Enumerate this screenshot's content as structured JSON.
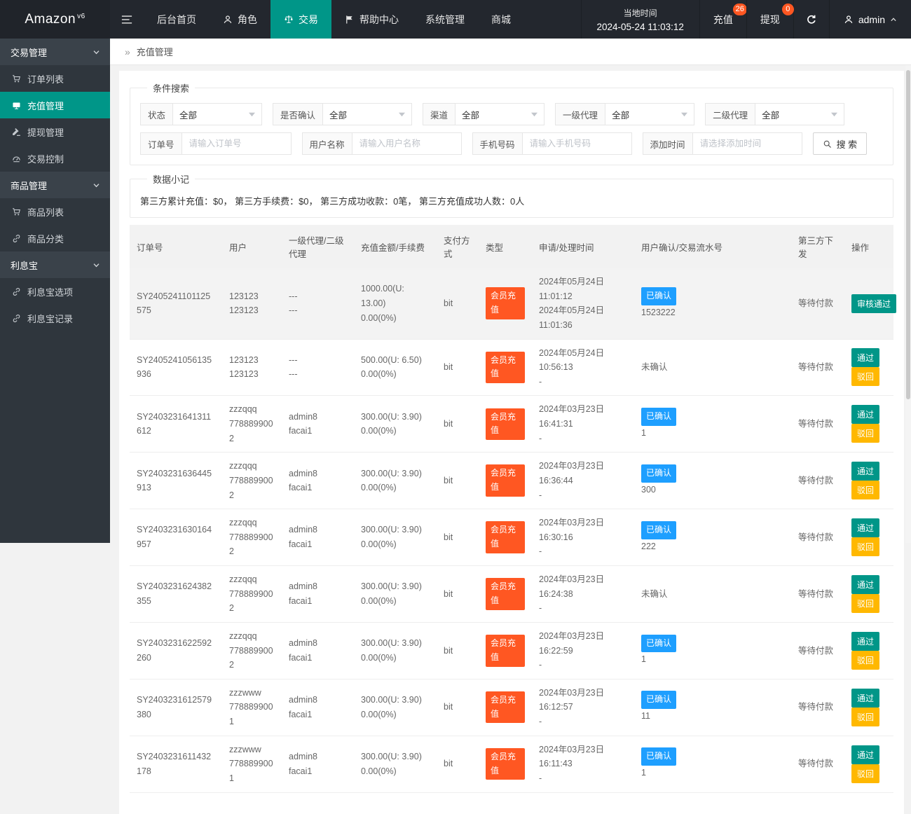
{
  "colors": {
    "accent": "#009688",
    "danger": "#ff5722",
    "info": "#1e9fff",
    "warning": "#ffb800",
    "navbar_bg": "#23272e",
    "sidebar_bg": "#2f363d"
  },
  "navbar": {
    "logo": {
      "text": "Amazon",
      "version": "v6"
    },
    "menu": [
      {
        "name": "home",
        "label": "后台首页",
        "icon": null,
        "active": false
      },
      {
        "name": "roles",
        "label": "角色",
        "icon": "user",
        "active": false
      },
      {
        "name": "trade",
        "label": "交易",
        "icon": "scales",
        "active": true
      },
      {
        "name": "help",
        "label": "帮助中心",
        "icon": "flag",
        "active": false
      },
      {
        "name": "system",
        "label": "系统管理",
        "icon": null,
        "active": false
      },
      {
        "name": "mall",
        "label": "商城",
        "icon": null,
        "active": false
      }
    ],
    "time": {
      "label": "当地时间",
      "value": "2024-05-24 11:03:12"
    },
    "quick": [
      {
        "label": "充值",
        "badge": "26"
      },
      {
        "label": "提现",
        "badge": "0"
      }
    ],
    "user": {
      "name": "admin"
    }
  },
  "sidebar": {
    "groups": [
      {
        "name": "trade-management",
        "label": "交易管理",
        "items": [
          {
            "name": "order-list",
            "label": "订单列表",
            "icon": "cart",
            "active": false
          },
          {
            "name": "recharge-management",
            "label": "充值管理",
            "icon": "card",
            "active": true
          },
          {
            "name": "withdraw-management",
            "label": "提现管理",
            "icon": "gavel",
            "active": false
          },
          {
            "name": "trade-control",
            "label": "交易控制",
            "icon": "gauge",
            "active": false
          }
        ]
      },
      {
        "name": "product-management",
        "label": "商品管理",
        "items": [
          {
            "name": "product-list",
            "label": "商品列表",
            "icon": "cart",
            "active": false
          },
          {
            "name": "product-category",
            "label": "商品分类",
            "icon": "link",
            "active": false
          }
        ]
      },
      {
        "name": "interest-bao",
        "label": "利息宝",
        "items": [
          {
            "name": "interest-options",
            "label": "利息宝选项",
            "icon": "link",
            "active": false
          },
          {
            "name": "interest-records",
            "label": "利息宝记录",
            "icon": "link",
            "active": false
          }
        ]
      }
    ]
  },
  "breadcrumb": {
    "icon": "»",
    "label": "充值管理"
  },
  "search": {
    "legend": "条件搜索",
    "selects": [
      {
        "name": "status-select",
        "label": "状态",
        "value": "全部"
      },
      {
        "name": "confirm-select",
        "label": "是否确认",
        "value": "全部"
      },
      {
        "name": "channel-select",
        "label": "渠道",
        "value": "全部"
      },
      {
        "name": "agent1-select",
        "label": "一级代理",
        "value": "全部"
      },
      {
        "name": "agent2-select",
        "label": "二级代理",
        "value": "全部"
      }
    ],
    "inputs": [
      {
        "name": "order-no-input",
        "label": "订单号",
        "placeholder": "请输入订单号"
      },
      {
        "name": "username-input",
        "label": "用户名称",
        "placeholder": "请输入用户名称"
      },
      {
        "name": "phone-input",
        "label": "手机号码",
        "placeholder": "请输入手机号码"
      },
      {
        "name": "add-time-input",
        "label": "添加时间",
        "placeholder": "请选择添加时间"
      }
    ],
    "button_label": "搜 索"
  },
  "summary": {
    "legend": "数据小记",
    "text": "第三方累计充值：$0， 第三方手续费：$0， 第三方成功收款：0笔， 第三方充值成功人数：0人"
  },
  "table": {
    "headers": [
      "订单号",
      "用户",
      "一级代理/二级代理",
      "充值金额/手续费",
      "支付方式",
      "类型",
      "申请/处理时间",
      "用户确认/交易流水号",
      "第三方下发",
      "操作"
    ],
    "rows": [
      {
        "order_no": "SY2405241101125575",
        "user": [
          "123123",
          "123123"
        ],
        "agents": [
          "---",
          "---"
        ],
        "amount": [
          "1000.00(U: 13.00)",
          "0.00(0%)"
        ],
        "pay": "bit",
        "type": "会员充值",
        "time": [
          "2024年05月24日 11:01:12",
          "2024年05月24日 11:01:36"
        ],
        "confirm": {
          "confirmed": true,
          "label": "已确认",
          "serial": "1523222"
        },
        "third": "等待付款",
        "highlight": true,
        "actions": [
          {
            "name": "approve-button",
            "label": "审核通过",
            "color": "green"
          }
        ]
      },
      {
        "order_no": "SY2405241056135936",
        "user": [
          "123123",
          "123123"
        ],
        "agents": [
          "---",
          "---"
        ],
        "amount": [
          "500.00(U: 6.50)",
          "0.00(0%)"
        ],
        "pay": "bit",
        "type": "会员充值",
        "time": [
          "2024年05月24日 10:56:13",
          "-"
        ],
        "confirm": {
          "confirmed": false,
          "label": "未确认",
          "serial": null
        },
        "third": "等待付款",
        "highlight": false,
        "actions": [
          {
            "name": "approve-button",
            "label": "通过",
            "color": "green"
          },
          {
            "name": "reject-button",
            "label": "驳回",
            "color": "yellow"
          }
        ]
      },
      {
        "order_no": "SY2403231641311612",
        "user": [
          "zzzqqq",
          "7788899002"
        ],
        "agents": [
          "admin8",
          "facai1"
        ],
        "amount": [
          "300.00(U: 3.90)",
          "0.00(0%)"
        ],
        "pay": "bit",
        "type": "会员充值",
        "time": [
          "2024年03月23日 16:41:31",
          "-"
        ],
        "confirm": {
          "confirmed": true,
          "label": "已确认",
          "serial": "1"
        },
        "third": "等待付款",
        "highlight": false,
        "actions": [
          {
            "name": "approve-button",
            "label": "通过",
            "color": "green"
          },
          {
            "name": "reject-button",
            "label": "驳回",
            "color": "yellow"
          }
        ]
      },
      {
        "order_no": "SY2403231636445913",
        "user": [
          "zzzqqq",
          "7788899002"
        ],
        "agents": [
          "admin8",
          "facai1"
        ],
        "amount": [
          "300.00(U: 3.90)",
          "0.00(0%)"
        ],
        "pay": "bit",
        "type": "会员充值",
        "time": [
          "2024年03月23日 16:36:44",
          "-"
        ],
        "confirm": {
          "confirmed": true,
          "label": "已确认",
          "serial": "300"
        },
        "third": "等待付款",
        "highlight": false,
        "actions": [
          {
            "name": "approve-button",
            "label": "通过",
            "color": "green"
          },
          {
            "name": "reject-button",
            "label": "驳回",
            "color": "yellow"
          }
        ]
      },
      {
        "order_no": "SY2403231630164957",
        "user": [
          "zzzqqq",
          "7788899002"
        ],
        "agents": [
          "admin8",
          "facai1"
        ],
        "amount": [
          "300.00(U: 3.90)",
          "0.00(0%)"
        ],
        "pay": "bit",
        "type": "会员充值",
        "time": [
          "2024年03月23日 16:30:16",
          "-"
        ],
        "confirm": {
          "confirmed": true,
          "label": "已确认",
          "serial": "222"
        },
        "third": "等待付款",
        "highlight": false,
        "actions": [
          {
            "name": "approve-button",
            "label": "通过",
            "color": "green"
          },
          {
            "name": "reject-button",
            "label": "驳回",
            "color": "yellow"
          }
        ]
      },
      {
        "order_no": "SY2403231624382355",
        "user": [
          "zzzqqq",
          "7788899002"
        ],
        "agents": [
          "admin8",
          "facai1"
        ],
        "amount": [
          "300.00(U: 3.90)",
          "0.00(0%)"
        ],
        "pay": "bit",
        "type": "会员充值",
        "time": [
          "2024年03月23日 16:24:38",
          "-"
        ],
        "confirm": {
          "confirmed": false,
          "label": "未确认",
          "serial": null
        },
        "third": "等待付款",
        "highlight": false,
        "actions": [
          {
            "name": "approve-button",
            "label": "通过",
            "color": "green"
          },
          {
            "name": "reject-button",
            "label": "驳回",
            "color": "yellow"
          }
        ]
      },
      {
        "order_no": "SY2403231622592260",
        "user": [
          "zzzqqq",
          "7788899002"
        ],
        "agents": [
          "admin8",
          "facai1"
        ],
        "amount": [
          "300.00(U: 3.90)",
          "0.00(0%)"
        ],
        "pay": "bit",
        "type": "会员充值",
        "time": [
          "2024年03月23日 16:22:59",
          "-"
        ],
        "confirm": {
          "confirmed": true,
          "label": "已确认",
          "serial": "1"
        },
        "third": "等待付款",
        "highlight": false,
        "actions": [
          {
            "name": "approve-button",
            "label": "通过",
            "color": "green"
          },
          {
            "name": "reject-button",
            "label": "驳回",
            "color": "yellow"
          }
        ]
      },
      {
        "order_no": "SY2403231612579380",
        "user": [
          "zzzwww",
          "7788899001"
        ],
        "agents": [
          "admin8",
          "facai1"
        ],
        "amount": [
          "300.00(U: 3.90)",
          "0.00(0%)"
        ],
        "pay": "bit",
        "type": "会员充值",
        "time": [
          "2024年03月23日 16:12:57",
          "-"
        ],
        "confirm": {
          "confirmed": true,
          "label": "已确认",
          "serial": "11"
        },
        "third": "等待付款",
        "highlight": false,
        "actions": [
          {
            "name": "approve-button",
            "label": "通过",
            "color": "green"
          },
          {
            "name": "reject-button",
            "label": "驳回",
            "color": "yellow"
          }
        ]
      },
      {
        "order_no": "SY2403231611432178",
        "user": [
          "zzzwww",
          "7788899001"
        ],
        "agents": [
          "admin8",
          "facai1"
        ],
        "amount": [
          "300.00(U: 3.90)",
          "0.00(0%)"
        ],
        "pay": "bit",
        "type": "会员充值",
        "time": [
          "2024年03月23日 16:11:43",
          "-"
        ],
        "confirm": {
          "confirmed": true,
          "label": "已确认",
          "serial": "1"
        },
        "third": "等待付款",
        "highlight": false,
        "actions": [
          {
            "name": "approve-button",
            "label": "通过",
            "color": "green"
          },
          {
            "name": "reject-button",
            "label": "驳回",
            "color": "yellow"
          }
        ]
      }
    ]
  }
}
